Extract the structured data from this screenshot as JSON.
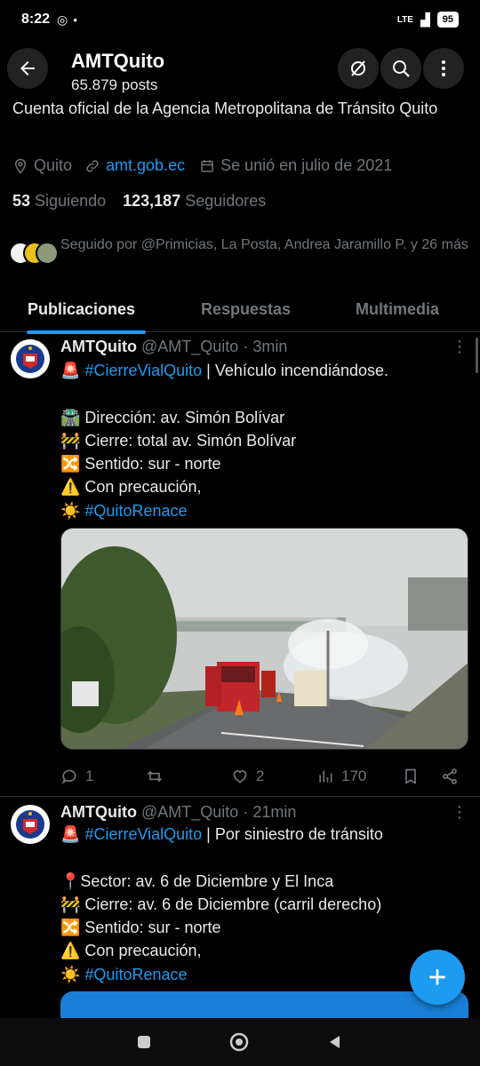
{
  "status": {
    "time": "8:22",
    "network": "LTE",
    "battery": "95"
  },
  "header": {
    "title": "AMTQuito",
    "posts": "65.879 posts"
  },
  "profile": {
    "bio": "Cuenta oficial de la Agencia Metropolitana de Tránsito Quito",
    "location": "Quito",
    "website": "amt.gob.ec",
    "joined": "Se unió en julio de 2021",
    "following_count": "53",
    "following_label": "Siguiendo",
    "followers_count": "123,187",
    "followers_label": "Seguidores",
    "followed_by": "Seguido por @Primicias, La Posta, Andrea Jaramillo P. y 26 más"
  },
  "tabs": [
    {
      "label": "Publicaciones"
    },
    {
      "label": "Respuestas"
    },
    {
      "label": "Multimedia"
    }
  ],
  "tweets": [
    {
      "name": "AMTQuito",
      "handle": "@AMT_Quito",
      "time": "· 3min",
      "more": "⋮",
      "lines": [
        {
          "emoji": "🚨",
          "tag": "#CierreVialQuito",
          "text": " | Vehículo incendiándose."
        },
        {
          "emoji": "",
          "tag": "",
          "text": ""
        },
        {
          "emoji": "🛣️",
          "tag": "",
          "text": " Dirección: av. Simón Bolívar"
        },
        {
          "emoji": "🚧",
          "tag": "",
          "text": " Cierre: total av. Simón Bolívar"
        },
        {
          "emoji": "🔀",
          "tag": "",
          "text": " Sentido: sur - norte"
        },
        {
          "emoji": "⚠️",
          "tag": "",
          "text": " Con precaución,"
        },
        {
          "emoji": " ☀️",
          "tag": " #QuitoRenace",
          "text": ""
        }
      ],
      "replies": "1",
      "retweets": "",
      "likes": "2",
      "views": "170"
    },
    {
      "name": "AMTQuito",
      "handle": "@AMT_Quito",
      "time": "· 21min",
      "more": "⋮",
      "lines": [
        {
          "emoji": "🚨",
          "tag": "#CierreVialQuito",
          "text": " | Por siniestro de tránsito"
        },
        {
          "emoji": "",
          "tag": "",
          "text": ""
        },
        {
          "emoji": "📍",
          "tag": "",
          "text": "Sector: av. 6 de Diciembre  y El Inca"
        },
        {
          "emoji": "🚧",
          "tag": "",
          "text": " Cierre: av. 6 de Diciembre (carril derecho)"
        },
        {
          "emoji": "🔀",
          "tag": "",
          "text": " Sentido: sur - norte"
        },
        {
          "emoji": "⚠️",
          "tag": "",
          "text": " Con precaución,"
        },
        {
          "emoji": " ☀️",
          "tag": " #QuitoRenace",
          "text": ""
        }
      ]
    }
  ],
  "colors": {
    "accent": "#1d9bf0",
    "muted": "#71767b",
    "text": "#e7e9ea",
    "background": "#000000"
  }
}
